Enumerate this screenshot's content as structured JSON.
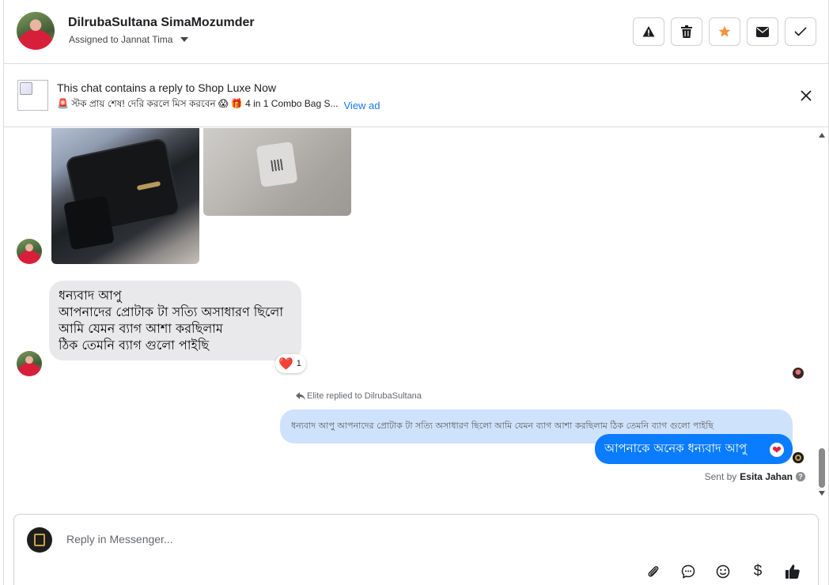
{
  "header": {
    "contact_name": "DilrubaSultana SimaMozumder",
    "assigned_label": "Assigned to Jannat Tima",
    "actions": [
      "warning-icon",
      "trash-icon",
      "star-icon",
      "envelope-icon",
      "check-icon"
    ]
  },
  "ad": {
    "title": "This chat contains a reply to Shop Luxe Now",
    "subtitle": "🚨 স্টক প্রায় শেষ! দেরি করলে মিস করবেন 😱 🎁 4 in 1 Combo Bag S...",
    "link": "View ad"
  },
  "messages": {
    "incoming_lines": [
      "ধন্যবাদ আপু",
      "আপনাদের প্রোটাক টা সত্যি অসাধারণ ছিলো",
      "আমি যেমন ব্যাগ আশা করছিলাম",
      "ঠিক তেমনি ব্যাগ গুলো পাইছি"
    ],
    "reaction_emoji": "❤️",
    "reaction_count": "1",
    "replied_label": "Elite replied to DilrubaSultana",
    "quoted_text": "ধন্যবাদ আপু আপনাদের প্রোটাক টা সত্যি অসাধারণ ছিলো আমি যেমন ব্যাগ আশা করছিলাম ঠিক তেমনি ব্যাগ গুলো পাইছি",
    "outgoing_text": "আপনাকে অনেক ধন্যবাদ আপু",
    "outgoing_reaction": "❤",
    "sent_by_prefix": "Sent by",
    "sent_by_name": "Esita Jahan"
  },
  "composer": {
    "placeholder": "Reply in Messenger...",
    "tools": [
      "paperclip-icon",
      "chat-bubble-icon",
      "emoji-icon",
      "dollar-icon",
      "thumbs-up-icon"
    ],
    "dollar_glyph": "$"
  },
  "colors": {
    "accent": "#0a7cff",
    "quoted_bg": "#cfe2fb",
    "incoming_bg": "#e9e9eb",
    "star": "#f7923a",
    "link": "#1877f2"
  }
}
